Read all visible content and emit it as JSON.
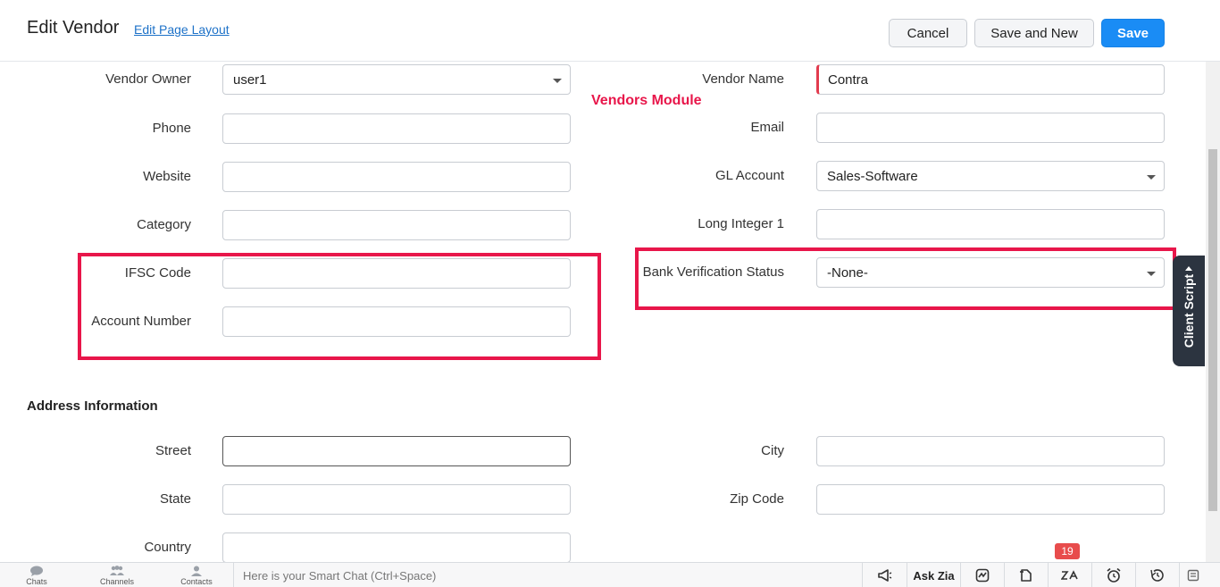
{
  "header": {
    "title": "Edit Vendor",
    "edit_layout_link": "Edit Page Layout",
    "cancel_label": "Cancel",
    "save_and_new_label": "Save and New",
    "save_label": "Save"
  },
  "annotation": "Vendors Module",
  "fields": {
    "vendor_owner": {
      "label": "Vendor Owner",
      "value": "user1"
    },
    "vendor_name": {
      "label": "Vendor Name",
      "value": "Contra"
    },
    "phone": {
      "label": "Phone",
      "value": ""
    },
    "email": {
      "label": "Email",
      "value": ""
    },
    "website": {
      "label": "Website",
      "value": ""
    },
    "gl_account": {
      "label": "GL Account",
      "value": "Sales-Software"
    },
    "category": {
      "label": "Category",
      "value": ""
    },
    "long_integer_1": {
      "label": "Long Integer 1",
      "value": ""
    },
    "ifsc_code": {
      "label": "IFSC Code",
      "value": ""
    },
    "bank_verification_status": {
      "label": "Bank Verification Status",
      "value": "-None-"
    },
    "account_number": {
      "label": "Account Number",
      "value": ""
    }
  },
  "address": {
    "section_title": "Address Information",
    "street": {
      "label": "Street",
      "value": ""
    },
    "city": {
      "label": "City",
      "value": ""
    },
    "state": {
      "label": "State",
      "value": ""
    },
    "zip_code": {
      "label": "Zip Code",
      "value": ""
    },
    "country": {
      "label": "Country",
      "value": ""
    }
  },
  "client_script_label": "Client Script",
  "bottom_bar": {
    "chats": "Chats",
    "channels": "Channels",
    "contacts": "Contacts",
    "smart_chat_placeholder": "Here is your Smart Chat (Ctrl+Space)",
    "ask_zia": "Ask Zia",
    "notification_count": "19"
  },
  "colors": {
    "primary_button": "#1a8cf5",
    "highlight": "#e8164a",
    "required_marker": "#e23b4e",
    "link": "#1e72c8"
  },
  "icons": [
    "caret-down-icon",
    "megaphone-icon",
    "signal-icon",
    "tag-icon",
    "zia-icon",
    "alarm-icon",
    "history-icon",
    "notes-icon",
    "chat-icon",
    "channels-icon",
    "contacts-icon"
  ]
}
